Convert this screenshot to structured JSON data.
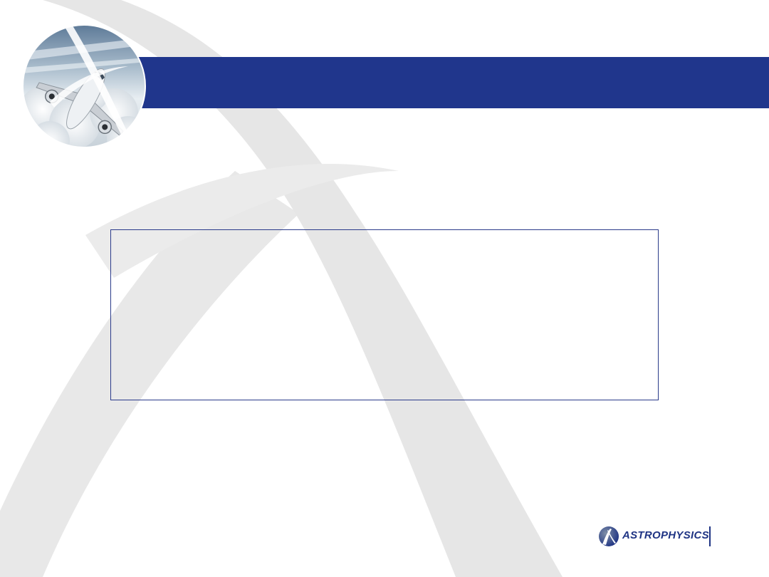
{
  "slide": {
    "title": "",
    "body": ""
  },
  "footer": {
    "logo_text": "ASTROPHYSICS",
    "logo_icon": "astrophysics-swoosh-icon"
  },
  "colors": {
    "title_bar": "#20368c",
    "content_border": "#2a3a8a",
    "swoosh": "#e6e6e6",
    "logo": "#1f3484"
  }
}
